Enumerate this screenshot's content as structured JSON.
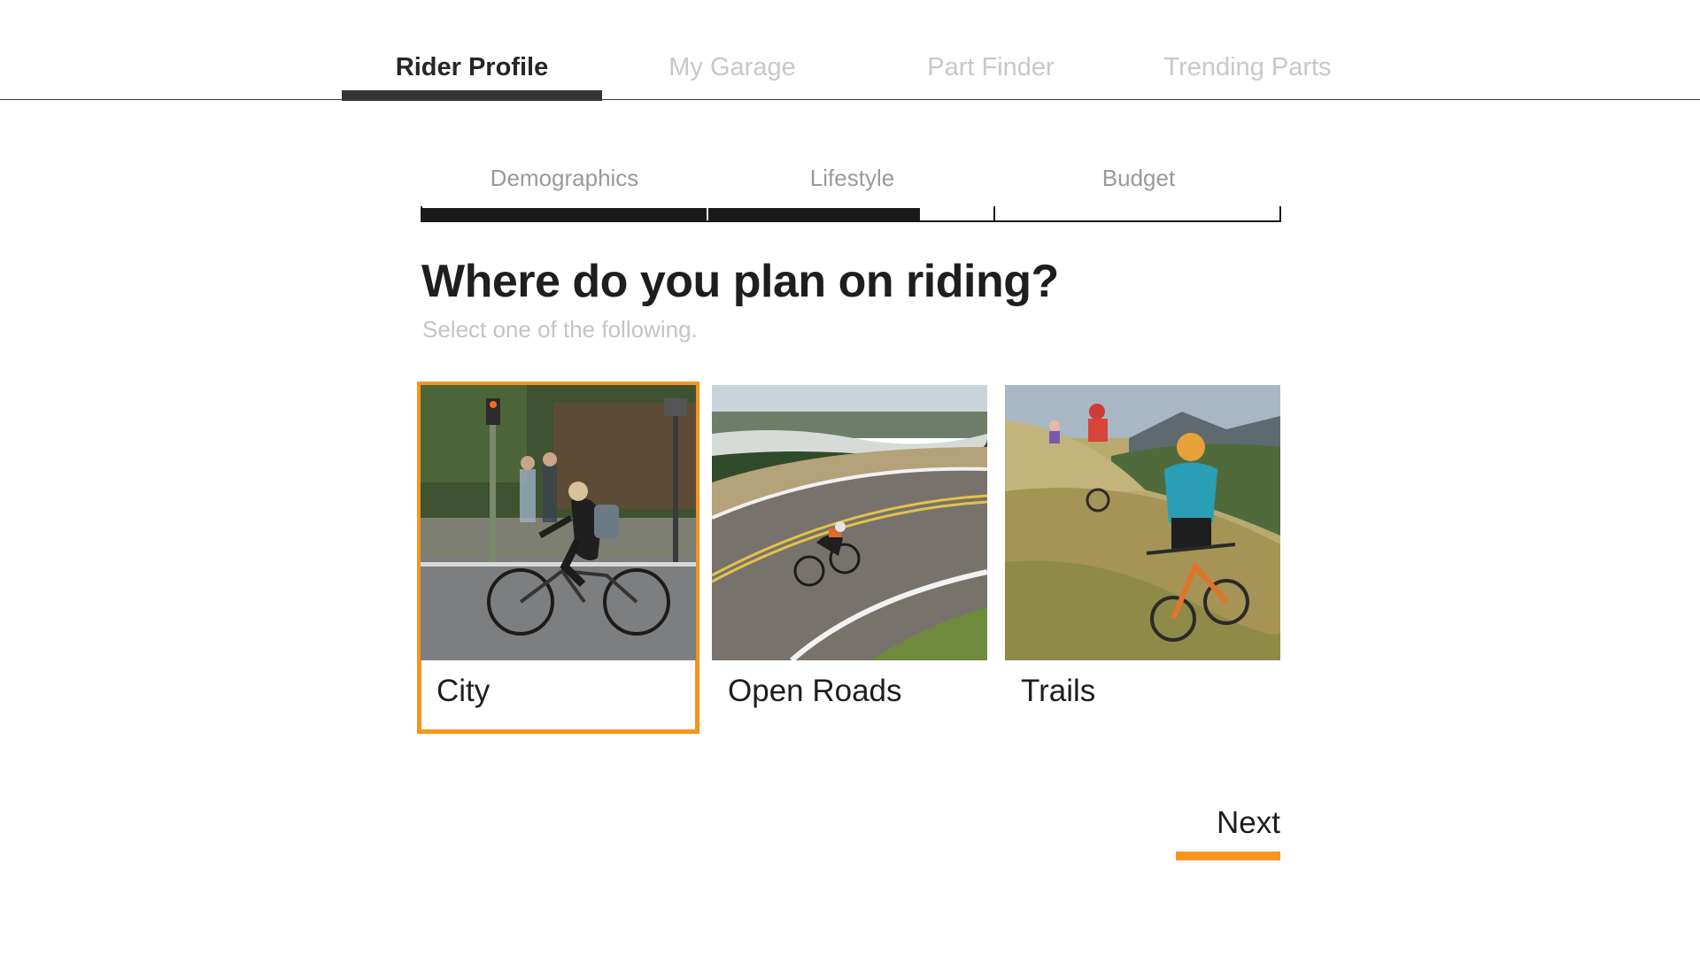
{
  "nav": {
    "tabs": [
      {
        "label": "Rider Profile",
        "active": true
      },
      {
        "label": "My Garage",
        "active": false
      },
      {
        "label": "Part Finder",
        "active": false
      },
      {
        "label": "Trending Parts",
        "active": false
      }
    ]
  },
  "steps": {
    "items": [
      {
        "label": "Demographics"
      },
      {
        "label": "Lifestyle"
      },
      {
        "label": "Budget"
      }
    ],
    "progress_fraction": 0.58
  },
  "question": {
    "title": "Where do you plan on riding?",
    "subtitle": "Select one of the following."
  },
  "options": [
    {
      "label": "City",
      "selected": true,
      "image": "city-cyclist-photo"
    },
    {
      "label": "Open Roads",
      "selected": false,
      "image": "road-cyclist-photo"
    },
    {
      "label": "Trails",
      "selected": false,
      "image": "mountain-bikers-photo"
    }
  ],
  "next": {
    "label": "Next"
  },
  "colors": {
    "accent": "#f7941d",
    "text_dark": "#1e1e1e",
    "text_muted": "#c4c4c4",
    "indicator": "#333333"
  }
}
